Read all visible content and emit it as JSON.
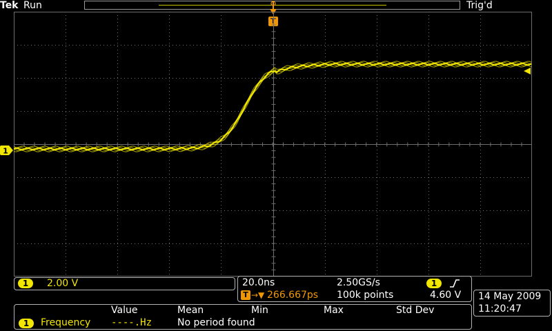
{
  "header": {
    "brand": "Tek",
    "run_state": "Run",
    "trigger_status": "Trig'd"
  },
  "markers": {
    "trigger_t": "T",
    "ch1_ground": "1"
  },
  "channel1": {
    "badge": "1",
    "scale": "2.00 V"
  },
  "timebase": {
    "scale": "20.0ns",
    "sample_rate": "2.50GS/s",
    "trigger_offset_prefix": "T",
    "trigger_offset_arrow": "→▼",
    "trigger_offset": "266.667ps",
    "record_length": "100k points",
    "trigger_source_badge": "1",
    "trigger_slope_icon": "rising-edge-icon",
    "trigger_level": "4.60 V"
  },
  "datetime": {
    "date": "14 May 2009",
    "time": "11:20:47"
  },
  "measurements": {
    "headers": [
      "Value",
      "Mean",
      "Min",
      "Max",
      "Std Dev"
    ],
    "rows": [
      {
        "source_badge": "1",
        "name": "Frequency",
        "value": "----.Hz",
        "mean": "No period found"
      }
    ]
  },
  "colors": {
    "ch1": "#f0e600",
    "trigger": "#f09600",
    "graticule": "#6e6e6e",
    "background": "#000000"
  }
}
